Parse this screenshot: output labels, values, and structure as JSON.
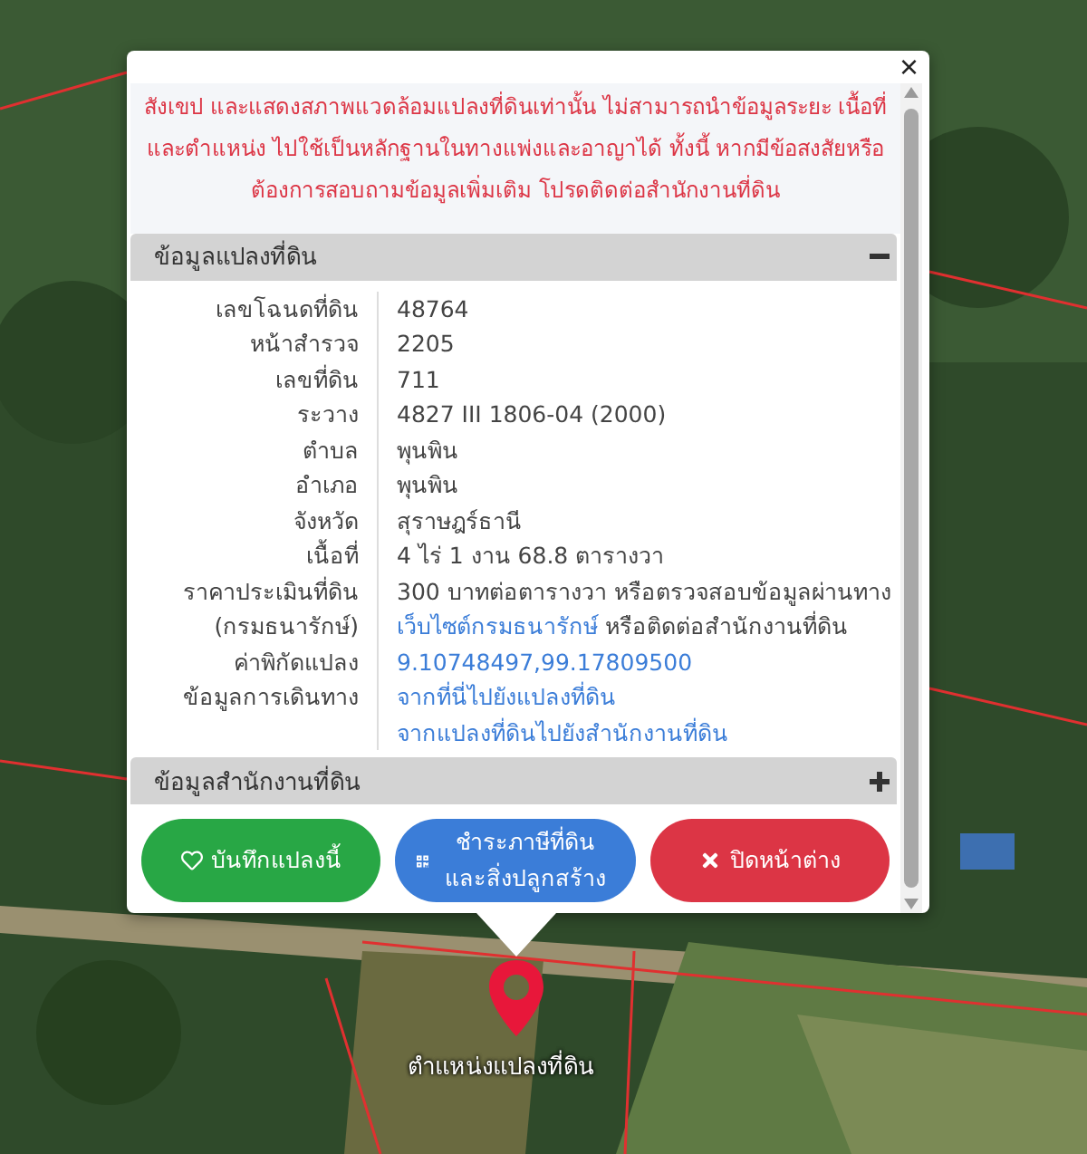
{
  "popup": {
    "close": "×",
    "notice": "สังเขป และแสดงสภาพแวดล้อมแปลงที่ดินเท่านั้น ไม่สามารถนำข้อมูลระยะ เนื้อที่และตำแหน่ง ไปใช้เป็นหลักฐานในทางแพ่งและอาญาได้ ทั้งนี้ หากมีข้อสงสัยหรือต้องการสอบถามข้อมูลเพิ่มเติม โปรดติดต่อสำนักงานที่ดิน",
    "sections": [
      {
        "title": "ข้อมูลแปลงที่ดิน",
        "expanded": true,
        "rows": [
          {
            "label": "เลขโฉนดที่ดิน",
            "parts": [
              {
                "kind": "text",
                "text": "48764"
              }
            ]
          },
          {
            "label": "หน้าสำรวจ",
            "parts": [
              {
                "kind": "text",
                "text": "2205"
              }
            ]
          },
          {
            "label": "เลขที่ดิน",
            "parts": [
              {
                "kind": "text",
                "text": "711"
              }
            ]
          },
          {
            "label": "ระวาง",
            "parts": [
              {
                "kind": "text",
                "text": "4827 III 1806-04 (2000)"
              }
            ]
          },
          {
            "label": "ตำบล",
            "parts": [
              {
                "kind": "text",
                "text": "พุนพิน"
              }
            ]
          },
          {
            "label": "อำเภอ",
            "parts": [
              {
                "kind": "text",
                "text": "พุนพิน"
              }
            ]
          },
          {
            "label": "จังหวัด",
            "parts": [
              {
                "kind": "text",
                "text": "สุราษฎร์ธานี"
              }
            ]
          },
          {
            "label": "เนื้อที่",
            "parts": [
              {
                "kind": "text",
                "text": "4 ไร่ 1 งาน 68.8 ตารางวา"
              }
            ]
          },
          {
            "label": "ราคาประเมินที่ดิน",
            "parts": [
              {
                "kind": "text",
                "text": "300 บาทต่อตารางวา หรือตรวจสอบข้อมูลผ่านทาง"
              }
            ]
          },
          {
            "label": "(กรมธนารักษ์)",
            "parts": [
              {
                "kind": "link",
                "text": "เว็บไซต์กรมธนารักษ์"
              },
              {
                "kind": "text",
                "text": " หรือติดต่อสำนักงานที่ดิน"
              }
            ]
          },
          {
            "label": "ค่าพิกัดแปลง",
            "parts": [
              {
                "kind": "link",
                "text": "9.10748497,99.17809500"
              }
            ]
          },
          {
            "label": "ข้อมูลการเดินทาง",
            "parts": [
              {
                "kind": "link",
                "text": "จากที่นี่ไปยังแปลงที่ดิน"
              }
            ]
          },
          {
            "parts": [
              {
                "kind": "link",
                "text": "จากแปลงที่ดินไปยังสำนักงานที่ดิน"
              }
            ]
          }
        ]
      },
      {
        "title": "ข้อมูลสำนักงานที่ดิน",
        "expanded": false
      }
    ],
    "buttons": [
      {
        "kind": "save",
        "label": "บันทึกแปลงนี้"
      },
      {
        "kind": "tax",
        "label": "ชำระภาษีที่ดินและสิ่งปลูกสร้าง"
      },
      {
        "kind": "close",
        "label": "ปิดหน้าต่าง"
      }
    ]
  },
  "marker": {
    "label": "ตำแหน่งแปลงที่ดิน"
  }
}
